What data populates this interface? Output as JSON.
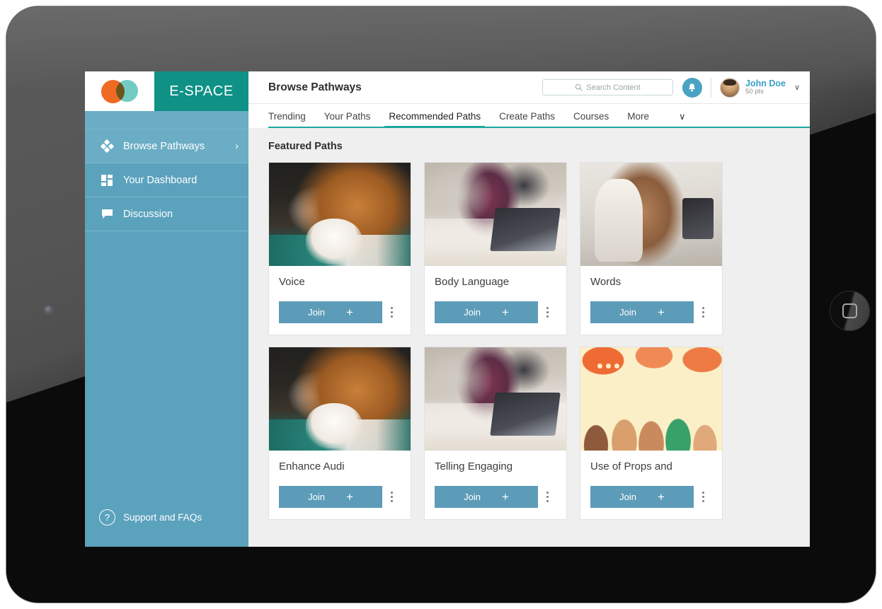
{
  "brand": {
    "name": "E-SPACE",
    "logo_icon": "two-overlapping-circles-logo",
    "orange": "#ef6a23",
    "teal": "#67c8bf",
    "bar_color": "#0f9186"
  },
  "sidebar": {
    "bg_color": "#5ba2bd",
    "items": [
      {
        "label": "Browse Pathways",
        "icon": "diamond-cluster-icon",
        "active": true,
        "chevron": "›"
      },
      {
        "label": "Your Dashboard",
        "icon": "grid-squares-icon",
        "active": false,
        "chevron": ""
      },
      {
        "label": "Discussion",
        "icon": "chat-bubble-icon",
        "active": false,
        "chevron": ""
      }
    ],
    "support": {
      "label": "Support and FAQs",
      "icon": "question-circle-icon",
      "glyph": "?"
    }
  },
  "topbar": {
    "title": "Browse Pathways",
    "search": {
      "placeholder": "Search Content",
      "value": "",
      "icon": "search-icon"
    },
    "notification": {
      "icon": "bell-icon"
    },
    "user": {
      "name": "John Doe",
      "points": "50 pts",
      "avatar": "user-avatar-photo",
      "caret": "∨"
    }
  },
  "tabs": {
    "items": [
      {
        "label": "Trending",
        "active": false
      },
      {
        "label": "Your Paths",
        "active": false
      },
      {
        "label": "Recommended Paths",
        "active": true
      },
      {
        "label": "Create Paths",
        "active": false
      },
      {
        "label": "Courses",
        "active": false
      },
      {
        "label": "More",
        "active": false
      }
    ],
    "overflow_caret": "∨",
    "accent_color": "#19a89c"
  },
  "content": {
    "section_title": "Featured Paths",
    "join_label": "Join",
    "join_plus": "+",
    "join_color": "#5d9cb8",
    "cards": [
      {
        "title": "Voice",
        "image": "woman-raising-hand-at-meeting-photo",
        "img_class": "img-voice"
      },
      {
        "title": "Body Language",
        "image": "people-writing-at-table-with-laptop-photo",
        "img_class": "img-body"
      },
      {
        "title": "Words",
        "image": "smiling-woman-with-phone-photo",
        "img_class": "img-words"
      },
      {
        "title": "Enhance Audi",
        "image": "woman-raising-hand-at-meeting-photo",
        "img_class": "img-voice"
      },
      {
        "title": "Telling Engaging",
        "image": "people-writing-at-table-with-laptop-photo",
        "img_class": "img-body"
      },
      {
        "title": "Use of Props and",
        "image": "illustration-group-of-people-with-speech-bubbles",
        "img_class": "img-props"
      }
    ]
  },
  "device": {
    "home_button": "home-button",
    "camera": "front-camera-dot"
  }
}
